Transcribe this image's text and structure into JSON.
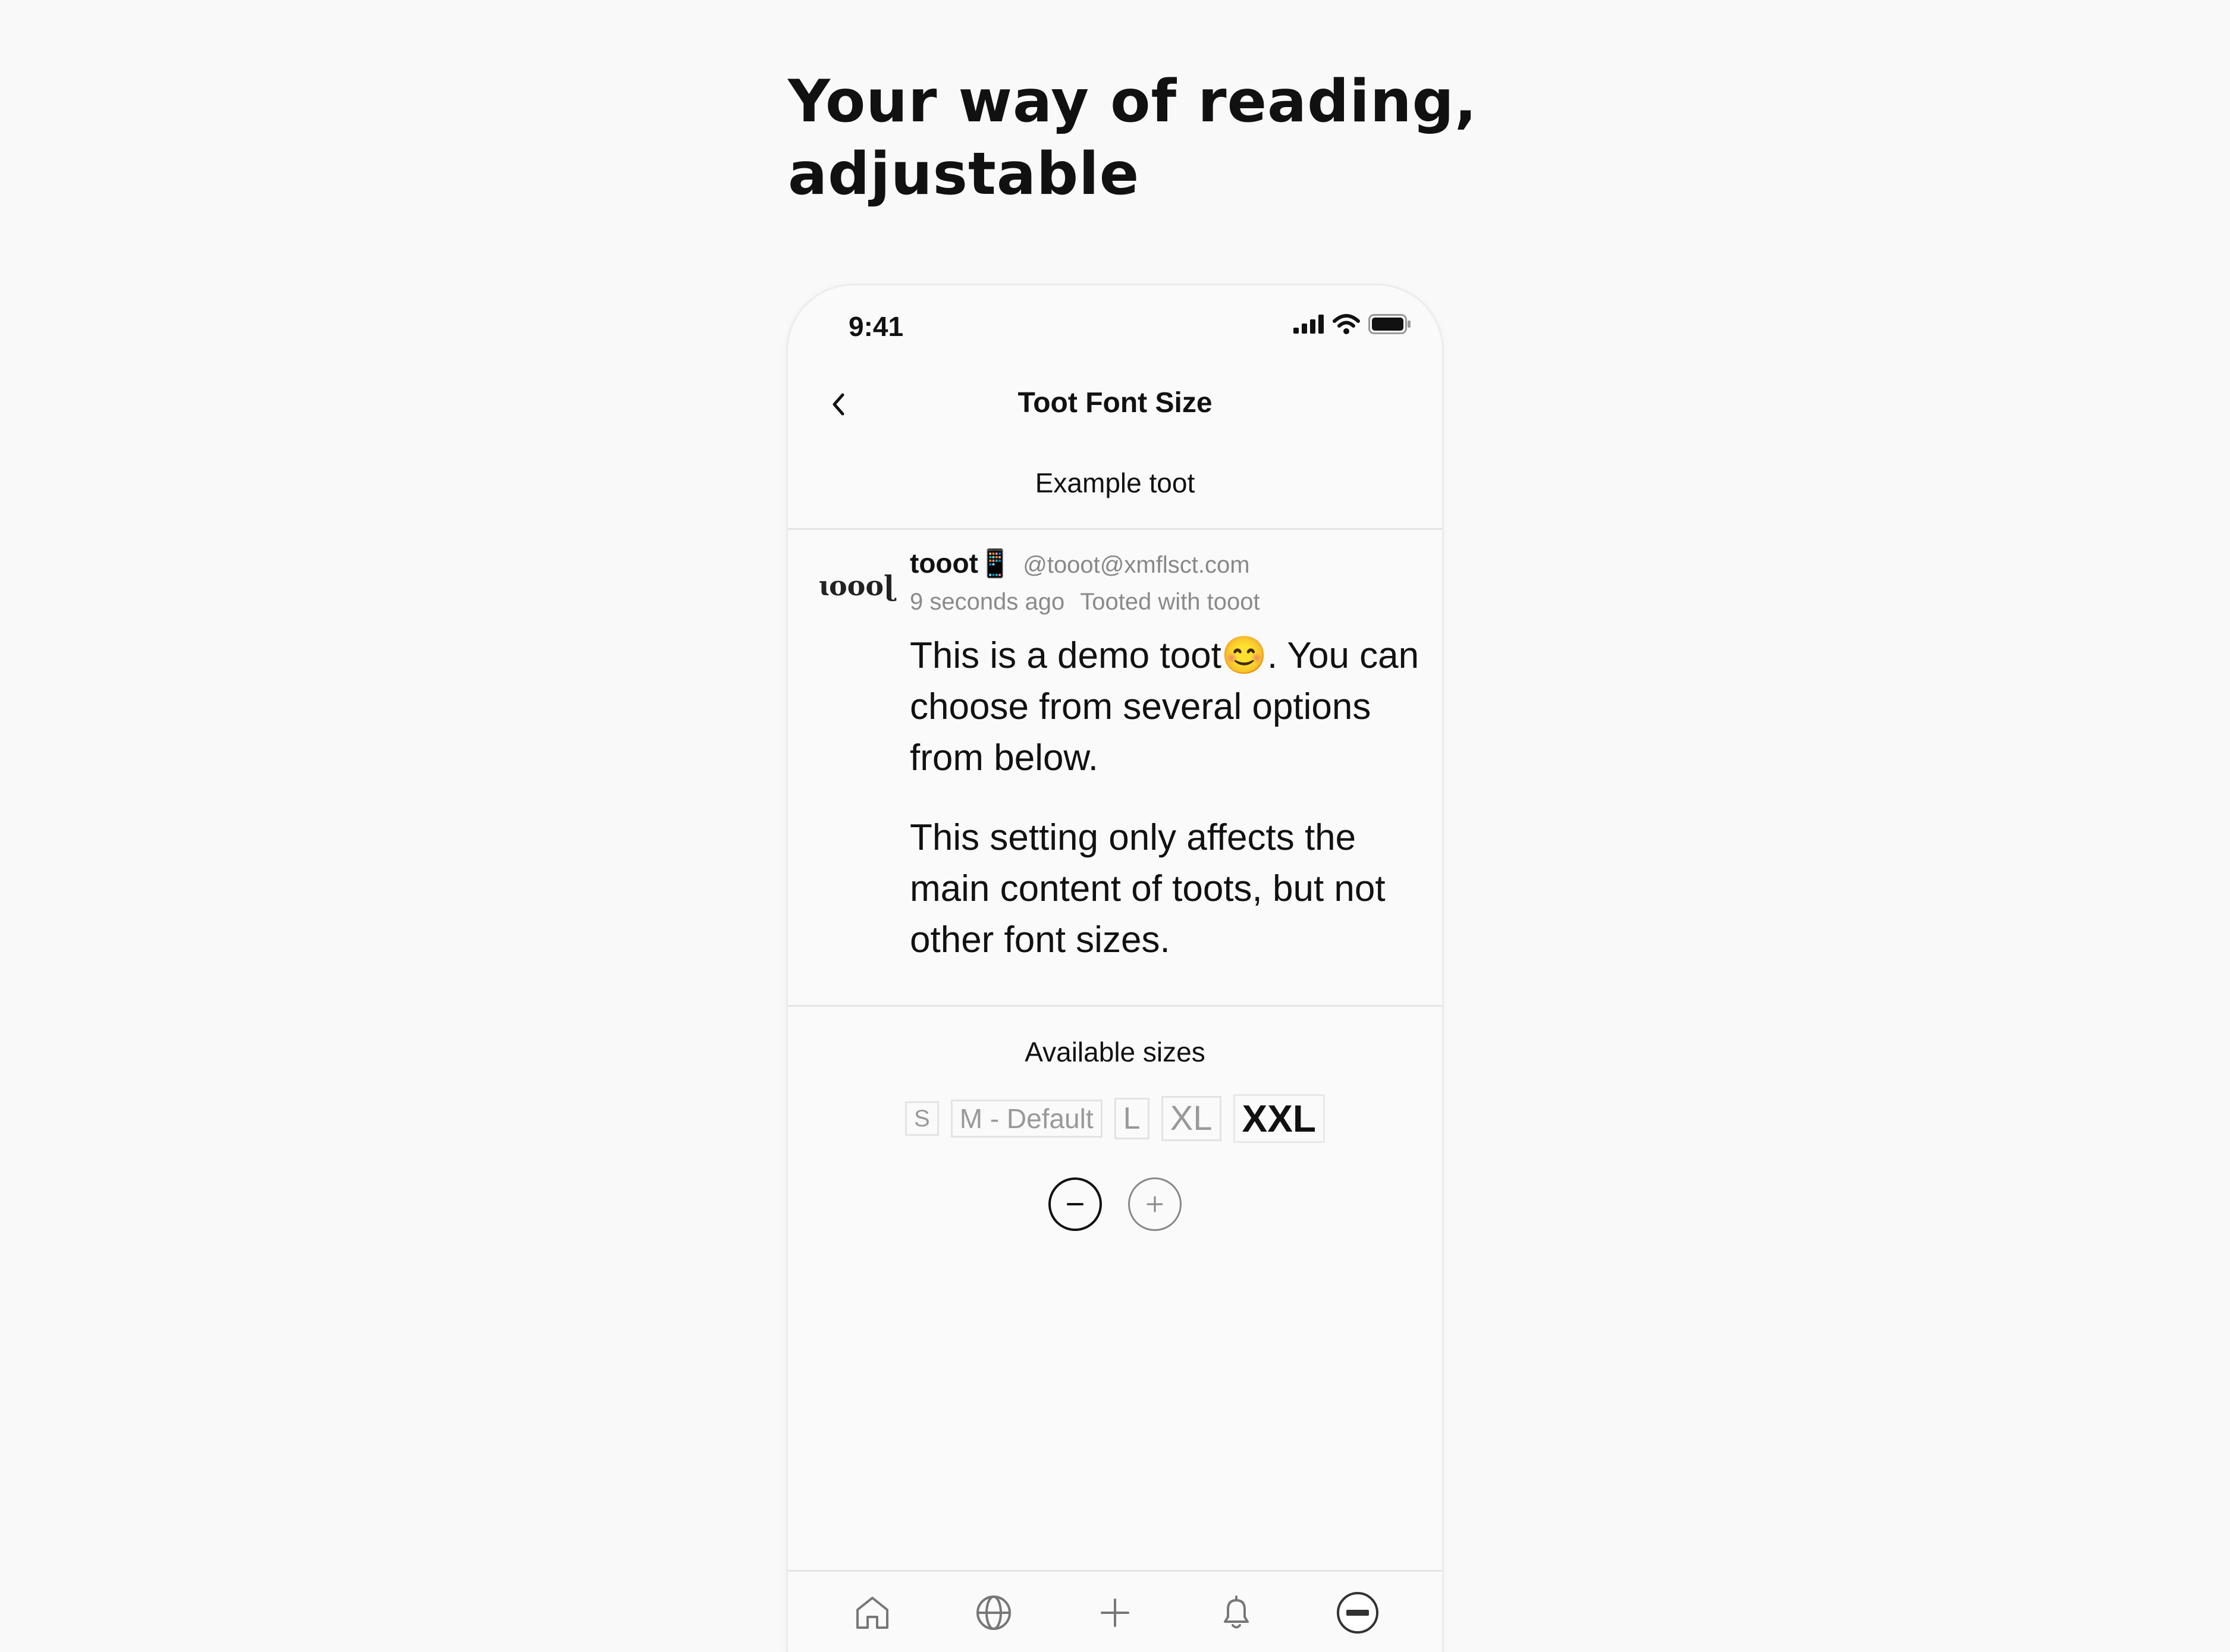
{
  "headline": {
    "line1": "Your way of reading,",
    "line2": "adjustable"
  },
  "status_bar": {
    "time": "9:41",
    "icons": [
      "signal-icon",
      "wifi-icon",
      "battery-icon"
    ]
  },
  "nav": {
    "title": "Toot Font Size",
    "back_icon": "chevron-left-icon"
  },
  "example_label": "Example toot",
  "toot": {
    "avatar_text": "ɩoooɭ",
    "display_name": "tooot📱",
    "handle": "@tooot@xmflsct.com",
    "time_ago": "9 seconds ago",
    "application": "Tooted with tooot",
    "paragraph1": "This is a demo toot😊. You can choose from several options from below.",
    "paragraph2": "This setting only affects the main content of toots, but not other font sizes."
  },
  "available_label": "Available sizes",
  "sizes": [
    {
      "label": "S",
      "selected": false
    },
    {
      "label": "M - Default",
      "selected": false
    },
    {
      "label": "L",
      "selected": false
    },
    {
      "label": "XL",
      "selected": false
    },
    {
      "label": "XXL",
      "selected": true
    }
  ],
  "tabs": [
    "home-icon",
    "globe-icon",
    "plus-icon",
    "bell-icon",
    "profile-avatar-icon"
  ],
  "colors": {
    "background": "#f9f9f9",
    "text": "#111111",
    "muted": "#888888",
    "border": "#e4e4e4"
  }
}
